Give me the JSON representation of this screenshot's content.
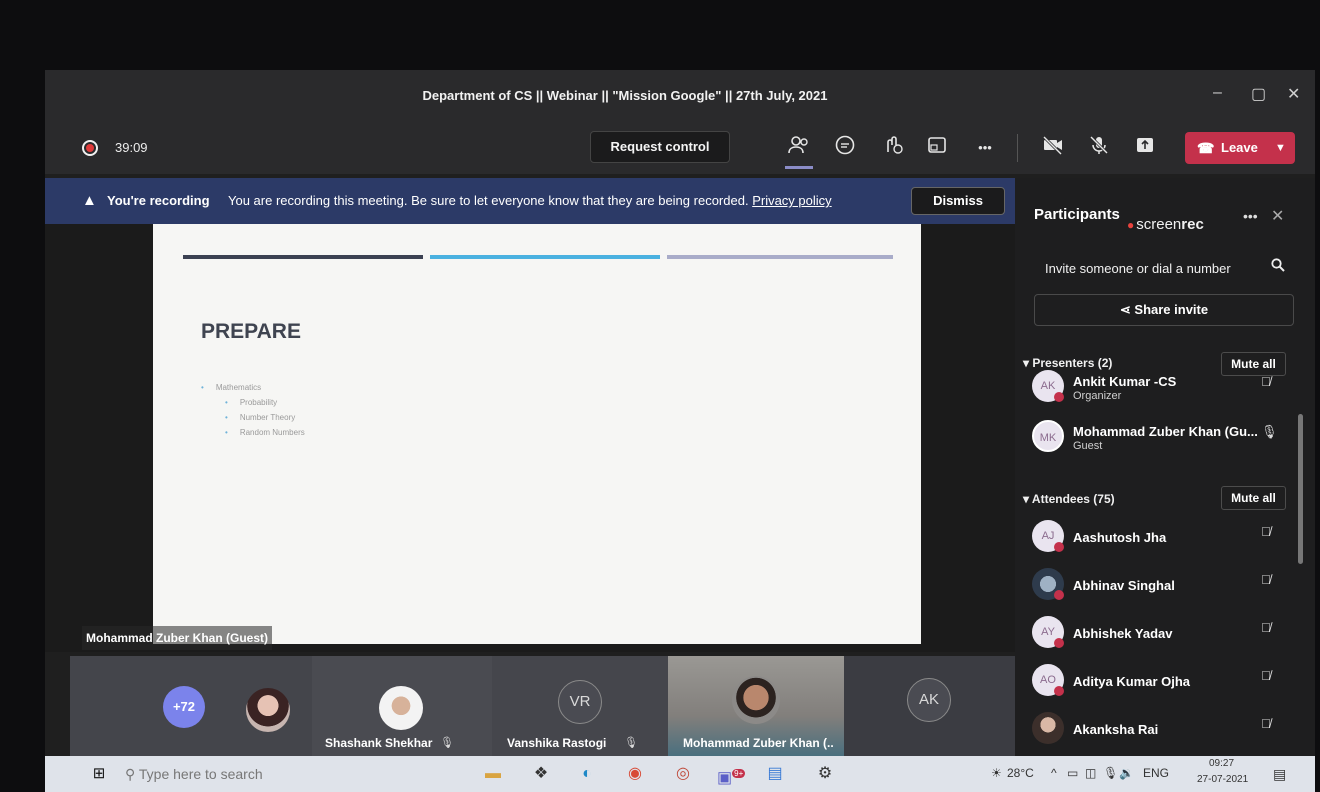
{
  "window": {
    "title": "Department of CS || Webinar || \"Mission Google\" || 27th July, 2021",
    "minimize": "–",
    "maximize": "▢",
    "close": "✕"
  },
  "toolbar": {
    "timer": "39:09",
    "request_control": "Request control",
    "leave_label": "Leave",
    "more": "•••"
  },
  "banner": {
    "title": "You're recording",
    "message": "You are recording this meeting. Be sure to let everyone know that they are being recorded.",
    "privacy_link": "Privacy policy",
    "dismiss": "Dismiss"
  },
  "slide": {
    "heading": "PREPARE",
    "bullets": [
      "Mathematics",
      "Probability",
      "Number Theory",
      "Random Numbers"
    ],
    "accent_colors": [
      "#3b4152",
      "#4ab1e0",
      "#a9acc9"
    ]
  },
  "stage": {
    "speaker_label": "Mohammad Zuber Khan (Guest)"
  },
  "video_strip": {
    "more_count": "+72",
    "tiles": [
      {
        "name": "Shashank Shekhar"
      },
      {
        "name": "Vanshika Rastogi",
        "initials": "VR"
      },
      {
        "name": "Mohammad Zuber Khan (..."
      },
      {
        "initials": "AK"
      }
    ]
  },
  "panel": {
    "title": "Participants",
    "watermark_light": "screen",
    "watermark_bold": "rec",
    "more": "•••",
    "close": "✕",
    "invite_placeholder": "Invite someone or dial a number",
    "share_invite": "Share invite",
    "presenters_header": "Presenters (2)",
    "attendees_header": "Attendees (75)",
    "mute_all": "Mute all",
    "presenters": [
      {
        "initials": "AK",
        "name": "Ankit Kumar -CS",
        "role": "Organizer"
      },
      {
        "initials": "MK",
        "name": "Mohammad Zuber Khan (Gu...",
        "role": "Guest"
      }
    ],
    "attendees": [
      {
        "initials": "AJ",
        "name": "Aashutosh Jha"
      },
      {
        "initials": "",
        "name": "Abhinav Singhal"
      },
      {
        "initials": "AY",
        "name": "Abhishek Yadav"
      },
      {
        "initials": "AO",
        "name": "Aditya Kumar Ojha"
      },
      {
        "initials": "",
        "name": "Akanksha Rai"
      }
    ]
  },
  "taskbar": {
    "search_placeholder": "Type here to search",
    "temperature": "28°C",
    "language": "ENG",
    "time": "09:27",
    "date": "27-07-2021",
    "teams_badge": "9+"
  },
  "colors": {
    "leave": "#c4314b",
    "banner": "#2c3a67",
    "accent": "#7b83eb"
  }
}
